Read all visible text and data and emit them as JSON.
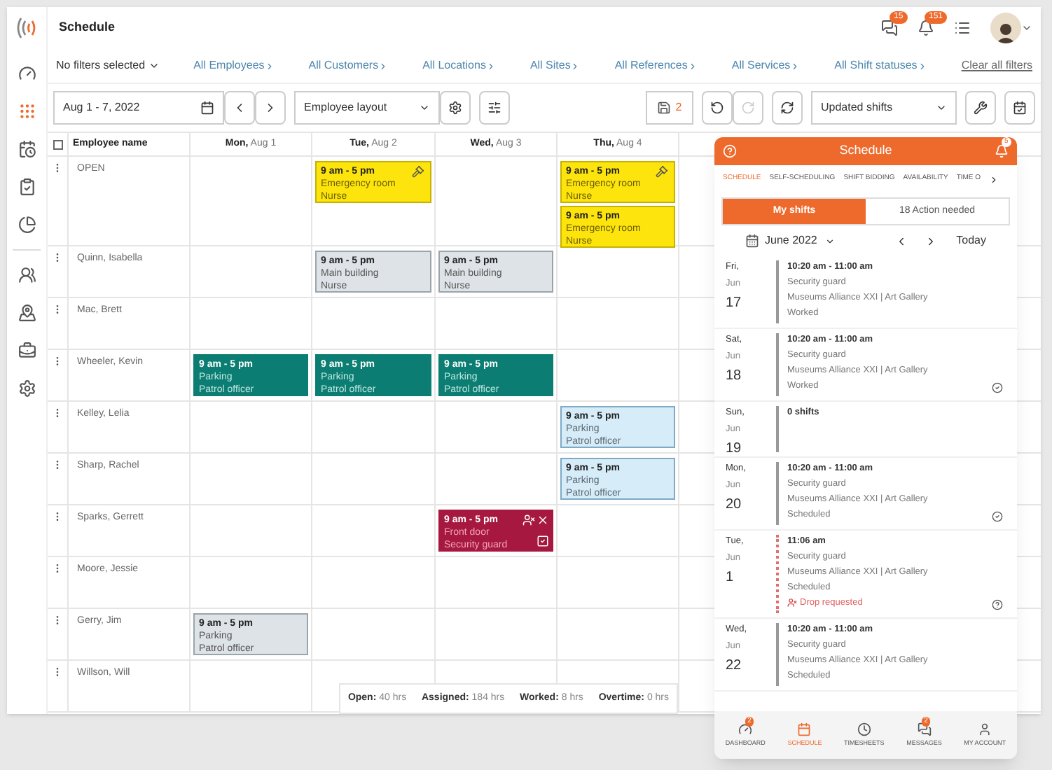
{
  "header": {
    "title": "Schedule",
    "chat_badge": "15",
    "bell_badge": "151"
  },
  "sidebar": {
    "items": [
      {
        "selected": false
      },
      {
        "selected": true
      },
      {
        "selected": false
      },
      {
        "selected": false
      },
      {
        "selected": false
      },
      {
        "selected": false
      },
      {
        "selected": false
      },
      {
        "selected": false
      },
      {
        "selected": false
      }
    ]
  },
  "filters": {
    "summary": "No filters selected",
    "links": [
      "All Employees",
      "All Customers",
      "All Locations",
      "All Sites",
      "All References",
      "All Services",
      "All Shift statuses"
    ],
    "clear": "Clear all filters"
  },
  "toolbar": {
    "date_range": "Aug 1 - 7, 2022",
    "layout": "Employee layout",
    "unsaved_count": "2",
    "view": "Updated shifts"
  },
  "grid": {
    "all_selected": false,
    "name_header": "Employee name",
    "days": [
      {
        "weekday": "Mon,",
        "date": "Aug 1"
      },
      {
        "weekday": "Tue,",
        "date": "Aug 2"
      },
      {
        "weekday": "Wed,",
        "date": "Aug 3"
      },
      {
        "weekday": "Thu,",
        "date": "Aug 4"
      }
    ],
    "rows": [
      {
        "name": "OPEN",
        "cells": [
          null,
          [
            {
              "kind": "open",
              "time": "9 am - 5 pm",
              "location": "Emergency room",
              "role": "Nurse",
              "bidding": true
            }
          ],
          null,
          [
            {
              "kind": "open",
              "time": "9 am - 5 pm",
              "location": "Emergency room",
              "role": "Nurse",
              "bidding": true
            },
            {
              "kind": "open",
              "time": "9 am - 5 pm",
              "location": "Emergency room",
              "role": "Nurse",
              "bidding": false
            }
          ]
        ]
      },
      {
        "name": "Quinn, Isabella",
        "cells": [
          null,
          [
            {
              "kind": "draft",
              "time": "9 am - 5 pm",
              "location": "Main building",
              "role": "Nurse",
              "bidding": false
            }
          ],
          [
            {
              "kind": "draft",
              "time": "9 am - 5 pm",
              "location": "Main building",
              "role": "Nurse",
              "bidding": false
            }
          ],
          null
        ]
      },
      {
        "name": "Mac, Brett",
        "cells": [
          null,
          null,
          null,
          null
        ]
      },
      {
        "name": "Wheeler, Kevin",
        "cells": [
          [
            {
              "kind": "published",
              "time": "9 am - 5 pm",
              "location": "Parking",
              "role": "Patrol officer",
              "bidding": false
            }
          ],
          [
            {
              "kind": "published",
              "time": "9 am - 5 pm",
              "location": "Parking",
              "role": "Patrol officer",
              "bidding": false
            }
          ],
          [
            {
              "kind": "published",
              "time": "9 am - 5 pm",
              "location": "Parking",
              "role": "Patrol officer",
              "bidding": false
            }
          ],
          null
        ]
      },
      {
        "name": "Kelley, Lelia",
        "cells": [
          null,
          null,
          null,
          [
            {
              "kind": "updated",
              "time": "9 am - 5 pm",
              "location": "Parking",
              "role": "Patrol officer",
              "bidding": false
            }
          ]
        ]
      },
      {
        "name": "Sharp, Rachel",
        "cells": [
          null,
          null,
          null,
          [
            {
              "kind": "updated",
              "time": "9 am - 5 pm",
              "location": "Parking",
              "role": "Patrol officer",
              "bidding": false
            }
          ]
        ]
      },
      {
        "name": "Sparks, Gerrett",
        "cells": [
          null,
          null,
          [
            {
              "kind": "declined",
              "time": "9 am - 5 pm",
              "location": "Front door",
              "role": "Security guard",
              "bidding": false,
              "checked": true
            }
          ],
          null
        ]
      },
      {
        "name": "Moore, Jessie",
        "cells": [
          null,
          null,
          null,
          null
        ]
      },
      {
        "name": "Gerry, Jim",
        "cells": [
          [
            {
              "kind": "draft",
              "time": "9 am - 5 pm",
              "location": "Parking",
              "role": "Patrol officer",
              "bidding": false
            }
          ],
          null,
          null,
          null
        ]
      },
      {
        "name": "Willson, Will",
        "cells": [
          null,
          null,
          null,
          null
        ]
      }
    ]
  },
  "totals": [
    {
      "label": "Open:",
      "value": "40 hrs"
    },
    {
      "label": "Assigned:",
      "value": "184 hrs"
    },
    {
      "label": "Worked:",
      "value": "8 hrs"
    },
    {
      "label": "Overtime:",
      "value": "0 hrs"
    }
  ],
  "panel": {
    "title": "Schedule",
    "notification_badge": "5",
    "tabs": [
      {
        "label": "SCHEDULE",
        "selected": true
      },
      {
        "label": "SELF-SCHEDULING",
        "selected": false
      },
      {
        "label": "SHIFT BIDDING",
        "selected": false
      },
      {
        "label": "AVAILABILITY",
        "selected": false
      },
      {
        "label": "TIME O",
        "selected": false
      }
    ],
    "segments": [
      {
        "label": "My shifts",
        "selected": true
      },
      {
        "label": "18 Action needed",
        "selected": false
      }
    ],
    "month": "June 2022",
    "today": "Today",
    "days": [
      {
        "weekday": "Fri,",
        "month": "Jun",
        "day": "17",
        "kind": "shift",
        "pending": false,
        "approved": false,
        "question": false,
        "time": "10:20 am - 11:00 am",
        "role": "Security guard",
        "place": "Museums Alliance XXI | Art Gallery",
        "status": "Worked"
      },
      {
        "weekday": "Sat,",
        "month": "Jun",
        "day": "18",
        "kind": "shift",
        "pending": false,
        "approved": true,
        "question": false,
        "time": "10:20 am - 11:00 am",
        "role": "Security guard",
        "place": "Museums Alliance XXI | Art Gallery",
        "status": "Worked"
      },
      {
        "weekday": "Sun,",
        "month": "Jun",
        "day": "19",
        "kind": "empty",
        "pending": false,
        "time": "0 shifts"
      },
      {
        "weekday": "Mon,",
        "month": "Jun",
        "day": "20",
        "kind": "shift",
        "pending": false,
        "approved": true,
        "question": false,
        "time": "10:20 am - 11:00 am",
        "role": "Security guard",
        "place": "Museums Alliance XXI | Art Gallery",
        "status": "Scheduled"
      },
      {
        "weekday": "Tue,",
        "month": "Jun",
        "day": "1",
        "kind": "shift",
        "pending": true,
        "approved": false,
        "question": true,
        "time": "11:06 am",
        "role": "Security guard",
        "place": "Museums Alliance XXI | Art Gallery",
        "status": "Scheduled",
        "alert": "Drop requested"
      },
      {
        "weekday": "Wed,",
        "month": "Jun",
        "day": "22",
        "kind": "shift",
        "pending": false,
        "approved": false,
        "question": false,
        "time": "10:20 am - 11:00 am",
        "role": "Security guard",
        "place": "Museums Alliance XXI | Art Gallery",
        "status": "Scheduled"
      }
    ],
    "nav": [
      {
        "label": "DASHBOARD",
        "badge": "2",
        "selected": false
      },
      {
        "label": "SCHEDULE",
        "selected": true
      },
      {
        "label": "TIMESHEETS",
        "selected": false
      },
      {
        "label": "MESSAGES",
        "badge": "2",
        "selected": false
      },
      {
        "label": "MY ACCOUNT",
        "selected": false
      }
    ]
  }
}
